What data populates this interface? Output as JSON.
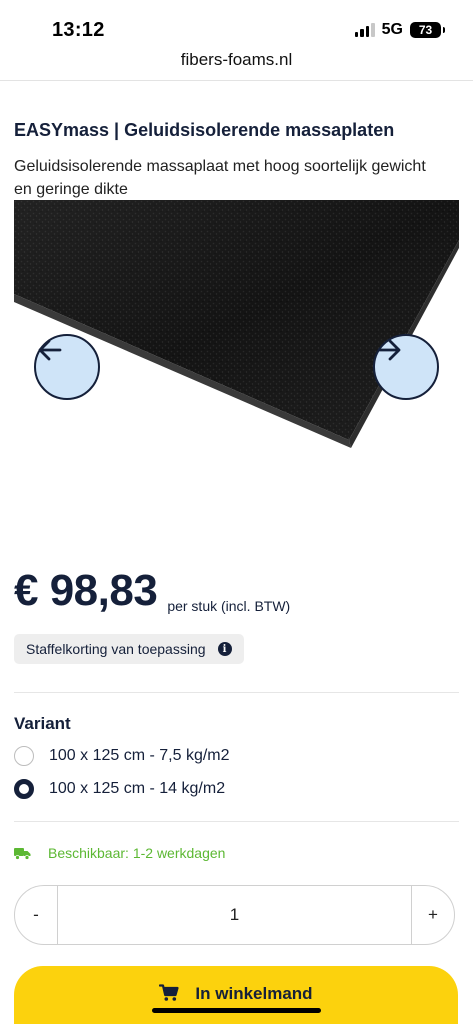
{
  "status_bar": {
    "time": "13:12",
    "network": "5G",
    "battery": "73"
  },
  "browser": {
    "url": "fibers-foams.nl"
  },
  "product": {
    "title": "EASYmass | Geluidsisolerende massaplaten",
    "description": "Geluidsisolerende massaplaat met hoog soortelijk gewicht en geringe dikte",
    "price": "€ 98,83",
    "price_unit": "per stuk (incl. BTW)",
    "discount_label": "Staffelkorting van toepassing",
    "info_icon_glyph": "i"
  },
  "gallery": {
    "prev_icon": "arrow-left-icon",
    "next_icon": "arrow-right-icon"
  },
  "variants": {
    "heading": "Variant",
    "options": [
      {
        "label": "100 x 125 cm - 7,5 kg/m2",
        "selected": false
      },
      {
        "label": "100 x 125 cm - 14 kg/m2",
        "selected": true
      }
    ]
  },
  "availability": {
    "text": "Beschikbaar: 1-2 werkdagen",
    "icon": "truck-icon"
  },
  "quantity": {
    "decrement_label": "-",
    "value": "1",
    "increment_label": "+"
  },
  "cart": {
    "label": "In winkelmand",
    "icon": "cart-icon"
  },
  "colors": {
    "navy": "#15203a",
    "accent_yellow": "#fcd20d",
    "arrow_bg": "#cfe4f8",
    "availability_green": "#5cb833"
  }
}
